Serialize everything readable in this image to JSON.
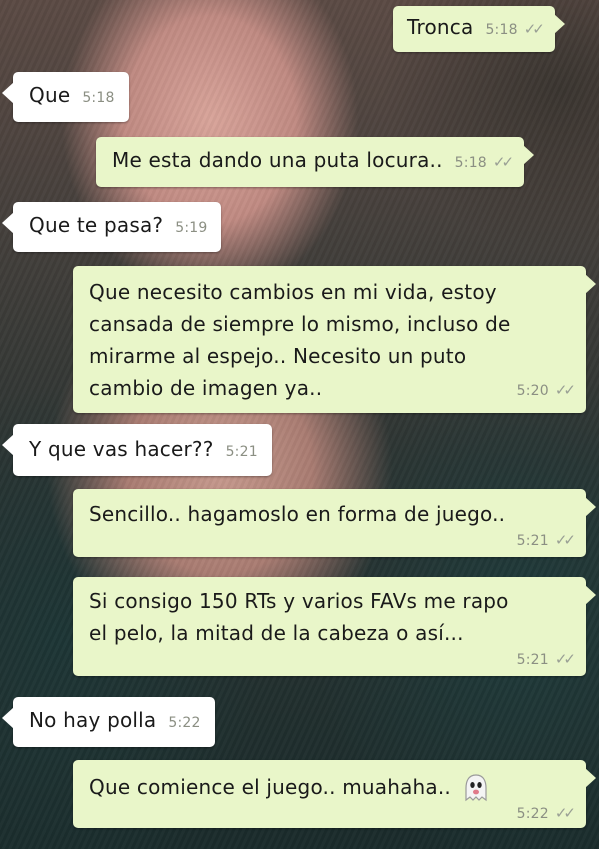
{
  "messages": [
    {
      "dir": "out",
      "text": "Tronca",
      "time": "5:18",
      "ticks": "✓✓"
    },
    {
      "dir": "in",
      "text": "Que",
      "time": "5:18"
    },
    {
      "dir": "out",
      "text": "Me esta dando una puta locura..",
      "time": "5:18",
      "ticks": "✓✓"
    },
    {
      "dir": "in",
      "text": "Que te pasa?",
      "time": "5:19"
    },
    {
      "dir": "out",
      "line1": "Que necesito cambios en mi vida, estoy",
      "line2": "cansada de siempre lo mismo, incluso de",
      "line3": "mirarme al espejo.. Necesito un puto",
      "line4": "cambio de imagen ya..",
      "time": "5:20",
      "ticks": "✓✓"
    },
    {
      "dir": "in",
      "text": "Y que vas hacer??",
      "time": "5:21"
    },
    {
      "dir": "out",
      "text": "Sencillo.. hagamoslo en forma de juego..",
      "time": "5:21",
      "ticks": "✓✓"
    },
    {
      "dir": "out",
      "line1": "Si consigo 150 RTs y varios FAVs me rapo",
      "line2": "el pelo, la mitad de la cabeza o así...",
      "time": "5:21",
      "ticks": "✓✓"
    },
    {
      "dir": "in",
      "text": "No hay polla",
      "time": "5:22"
    },
    {
      "dir": "out",
      "text": "Que comience el juego.. muahaha..",
      "emoji": "ghost-emoji",
      "time": "5:22",
      "ticks": "✓✓"
    }
  ],
  "colors": {
    "outgoing": "#e9f6c9",
    "incoming": "#ffffff",
    "meta": "#8b8f83"
  }
}
